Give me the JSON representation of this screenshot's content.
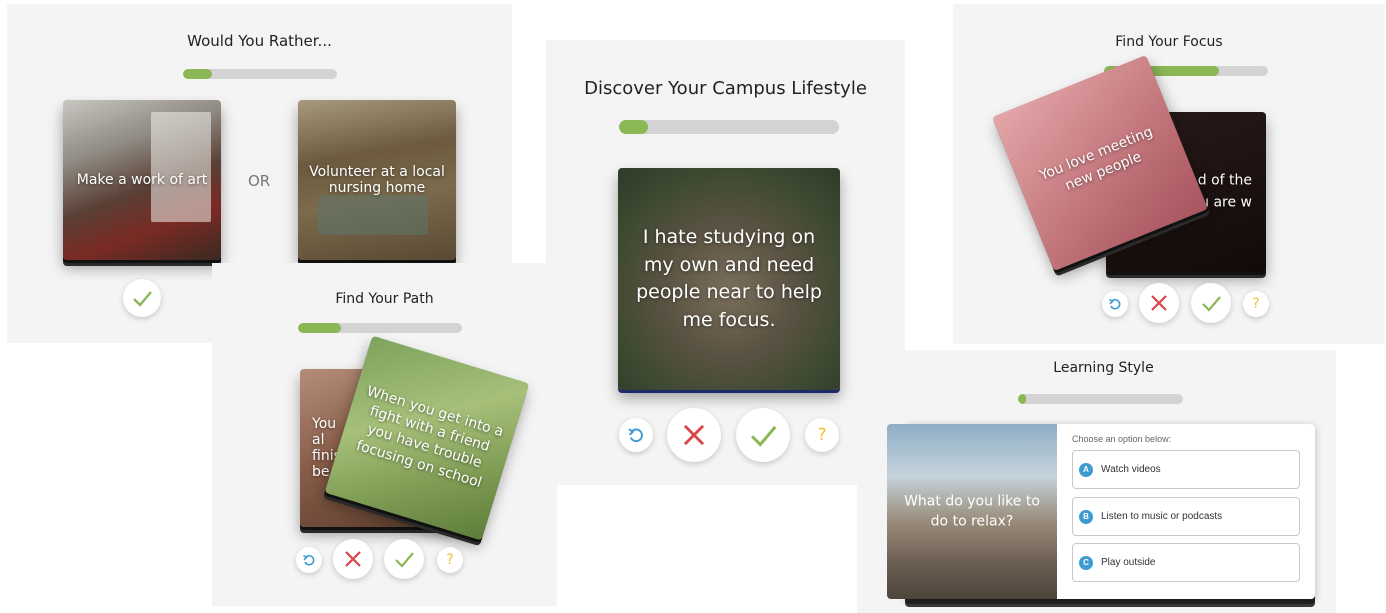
{
  "panels": {
    "would_you_rather": {
      "title": "Would You Rather...",
      "progress": 0.19,
      "option_a": "Make a work of art",
      "or_label": "OR",
      "option_b": "Volunteer at a local nursing home"
    },
    "find_your_path": {
      "title": "Find Your Path",
      "progress": 0.26,
      "back_card_text": "You al finis be",
      "front_card_text": "When you get into a fight with a friend you have trouble focusing on school"
    },
    "campus_lifestyle": {
      "title": "Discover Your Campus Lifestyle",
      "progress": 0.13,
      "card_text": "I hate studying on my own and need people near to help me focus."
    },
    "find_your_focus": {
      "title": "Find Your Focus",
      "progress": 0.7,
      "front_card_text": "You love meeting new people",
      "back_card_text": "d of the u are w"
    },
    "learning_style": {
      "title": "Learning Style",
      "progress": 0.05,
      "card_text": "What do you like to do to relax?",
      "prompt": "Choose an option below:",
      "options": [
        {
          "letter": "A",
          "label": "Watch videos"
        },
        {
          "letter": "B",
          "label": "Listen to music or podcasts"
        },
        {
          "letter": "C",
          "label": "Play outside"
        }
      ]
    }
  },
  "icons": {
    "undo": "undo-icon",
    "reject": "close-icon",
    "accept": "check-icon",
    "help": "question-icon"
  },
  "colors": {
    "progress_fill": "#8bb755",
    "progress_track": "#d3d3d3",
    "accept": "#8bb755",
    "reject": "#d9454a",
    "undo": "#3e9bd1",
    "help": "#f0c430"
  }
}
